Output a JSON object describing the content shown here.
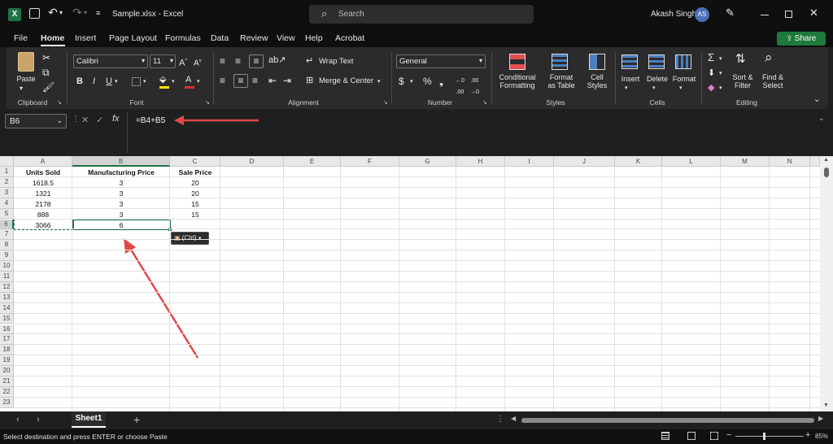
{
  "titlebar": {
    "app_icon": "excel-icon",
    "title": "Sample.xlsx  -  Excel",
    "search_placeholder": "Search",
    "user_name": "Akash Singh",
    "user_initials": "AS"
  },
  "menu": {
    "tabs": [
      "File",
      "Home",
      "Insert",
      "Page Layout",
      "Formulas",
      "Data",
      "Review",
      "View",
      "Help",
      "Acrobat"
    ],
    "active": "Home",
    "share_label": "Share"
  },
  "ribbon": {
    "clipboard": {
      "paste": "Paste",
      "label": "Clipboard"
    },
    "font": {
      "name": "Calibri",
      "size": "11",
      "label": "Font"
    },
    "alignment": {
      "wrap": "Wrap Text",
      "merge": "Merge & Center",
      "label": "Alignment"
    },
    "number": {
      "format": "General",
      "label": "Number"
    },
    "styles": {
      "conditional": "Conditional Formatting",
      "format_table": "Format as Table",
      "cell_styles": "Cell Styles",
      "label": "Styles"
    },
    "cells": {
      "insert": "Insert",
      "delete": "Delete",
      "format": "Format",
      "label": "Cells"
    },
    "editing": {
      "sort": "Sort & Filter",
      "find": "Find & Select",
      "label": "Editing"
    }
  },
  "formula_bar": {
    "name_box": "B6",
    "formula": "=B4+B5",
    "fx": "fx"
  },
  "grid": {
    "columns": [
      "A",
      "B",
      "C",
      "D",
      "E",
      "F",
      "G",
      "H",
      "I",
      "J",
      "K",
      "L",
      "M",
      "N"
    ],
    "rows": [
      "1",
      "2",
      "3",
      "4",
      "5",
      "6",
      "7",
      "8",
      "9",
      "10",
      "11",
      "12",
      "13",
      "14",
      "15",
      "16",
      "17",
      "18",
      "19",
      "20",
      "21",
      "22",
      "23"
    ],
    "headers": [
      "Units Sold",
      "Manufacturing Price",
      "Sale Price"
    ],
    "data": [
      [
        "1618.5",
        "3",
        "20"
      ],
      [
        "1321",
        "3",
        "20"
      ],
      [
        "2178",
        "3",
        "15"
      ],
      [
        "888",
        "3",
        "15"
      ],
      [
        "3066",
        "6",
        ""
      ]
    ],
    "paste_options": "(Ctrl)"
  },
  "sheets": {
    "active": "Sheet1"
  },
  "status": {
    "message": "Select destination and press ENTER or choose Paste",
    "zoom": "85%"
  },
  "colors": {
    "accent": "#217346",
    "arrow": "#e04848",
    "share": "#1e7a3c"
  }
}
